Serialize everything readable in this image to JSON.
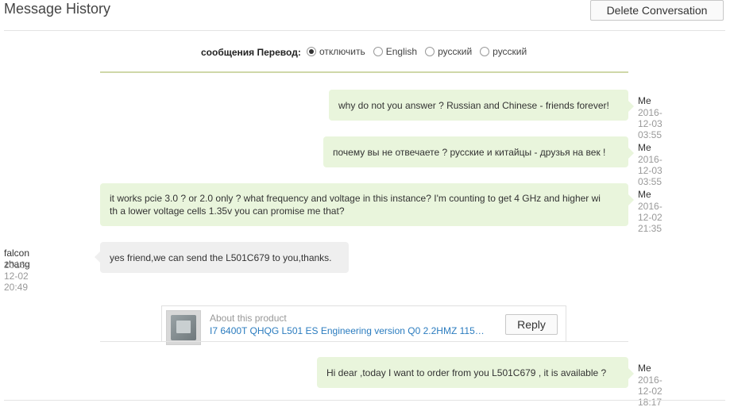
{
  "header": {
    "title": "Message History",
    "delete_label": "Delete Conversation"
  },
  "translate": {
    "label": "сообщения Перевод:",
    "options": [
      "отключить",
      "English",
      "русский",
      "русский"
    ],
    "selected_index": 0
  },
  "messages": [
    {
      "sender": "Me",
      "time": "2016-12-03 03:55",
      "text": "why do not you answer ? Russian and Chinese - friends forever!",
      "from_me": true
    },
    {
      "sender": "Me",
      "time": "2016-12-03 03:55",
      "text": "почему вы не отвечаете ? русские и китайцы - друзья на век !",
      "from_me": true
    },
    {
      "sender": "Me",
      "time": "2016-12-02 21:35",
      "text_line1": "it works pcie 3.0 ? or 2.0 only ? what frequency and voltage in this instance? I'm counting to get 4 GHz and higher wi",
      "text_line2": "th a lower voltage cells 1.35v you can promise me that?",
      "from_me": true
    },
    {
      "sender": "falcon zhang",
      "time": "2016-12-02 20:49",
      "text": "yes friend,we can send the L501C679 to you,thanks.",
      "from_me": false
    },
    {
      "sender": "Me",
      "time": "2016-12-02 18:17",
      "text": "Hi dear ,today I want to order from you L501C679 , it is available ?",
      "from_me": true
    }
  ],
  "product": {
    "about_label": "About this product",
    "title": "I7 6400T QHQG L501 ES Engineering version Q0 2.2HMZ 115…",
    "reply_label": "Reply",
    "thumb_icon": "cpu-chip-icon"
  },
  "colors": {
    "my_bubble": "#e9f5dc",
    "their_bubble": "#efefef",
    "link": "#2b7cbf",
    "timestamp": "#999999"
  }
}
